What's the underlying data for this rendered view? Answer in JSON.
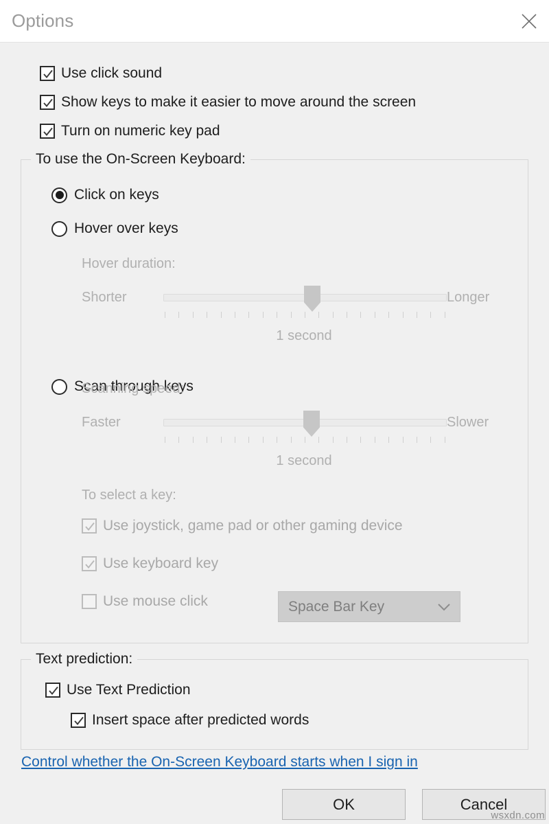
{
  "window": {
    "title": "Options",
    "close_icon": "close-icon"
  },
  "top_checkboxes": [
    {
      "label": "Use click sound",
      "checked": true,
      "enabled": true
    },
    {
      "label": "Show keys to make it easier to move around the screen",
      "checked": true,
      "enabled": true
    },
    {
      "label": "Turn on numeric key pad",
      "checked": true,
      "enabled": true
    }
  ],
  "keyboard_group": {
    "legend": "To use the On-Screen Keyboard:",
    "radios": [
      {
        "label": "Click on keys",
        "selected": true
      },
      {
        "label": "Hover over keys",
        "selected": false
      },
      {
        "label": "Scan through keys",
        "selected": false
      }
    ],
    "hover_slider": {
      "caption": "Hover duration:",
      "left_label": "Shorter",
      "right_label": "Longer",
      "value_label": "1 second",
      "position_percent": 51,
      "tick_count": 21,
      "enabled": false
    },
    "scan_slider": {
      "caption": "Scanning speed:",
      "left_label": "Faster",
      "right_label": "Slower",
      "value_label": "1 second",
      "position_percent": 51,
      "tick_count": 21,
      "enabled": false
    },
    "select_key": {
      "caption": "To select a key:",
      "checkboxes": [
        {
          "label": "Use joystick, game pad or other gaming device",
          "checked": true,
          "enabled": false
        },
        {
          "label": "Use keyboard key",
          "checked": true,
          "enabled": false
        },
        {
          "label": "Use mouse click",
          "checked": false,
          "enabled": false
        }
      ],
      "dropdown": {
        "value": "Space Bar Key",
        "enabled": false,
        "chevron_icon": "chevron-down-icon"
      }
    }
  },
  "text_prediction_group": {
    "legend": "Text prediction:",
    "checkboxes": [
      {
        "label": "Use Text Prediction",
        "checked": true,
        "enabled": true
      },
      {
        "label": "Insert space after predicted words",
        "checked": true,
        "enabled": true
      }
    ]
  },
  "footer": {
    "link": "Control whether the On-Screen Keyboard starts when I sign in",
    "ok_label": "OK",
    "cancel_label": "Cancel"
  },
  "watermark": "wsxdn.com",
  "colors": {
    "dialog_bg": "#f0f0f0",
    "titlebar_bg": "#ffffff",
    "title_text": "#9b9b9b",
    "body_text": "#1d1d1d",
    "disabled_text": "#a8a8a8",
    "link": "#1863b0",
    "slider_thumb": "#c6c6c6",
    "combo_bg": "#cdcdcd",
    "button_bg": "#e6e6e6"
  }
}
